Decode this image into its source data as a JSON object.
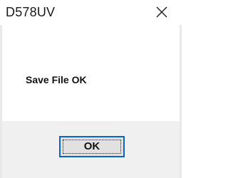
{
  "window": {
    "title": "D578UV",
    "close_icon": "close-icon"
  },
  "dialog": {
    "message": "Save File OK",
    "ok_label": "OK"
  },
  "colors": {
    "footer_bg": "#f0f0f0",
    "button_bg": "#e1e1e1",
    "button_focus_border": "#0a64c8"
  }
}
